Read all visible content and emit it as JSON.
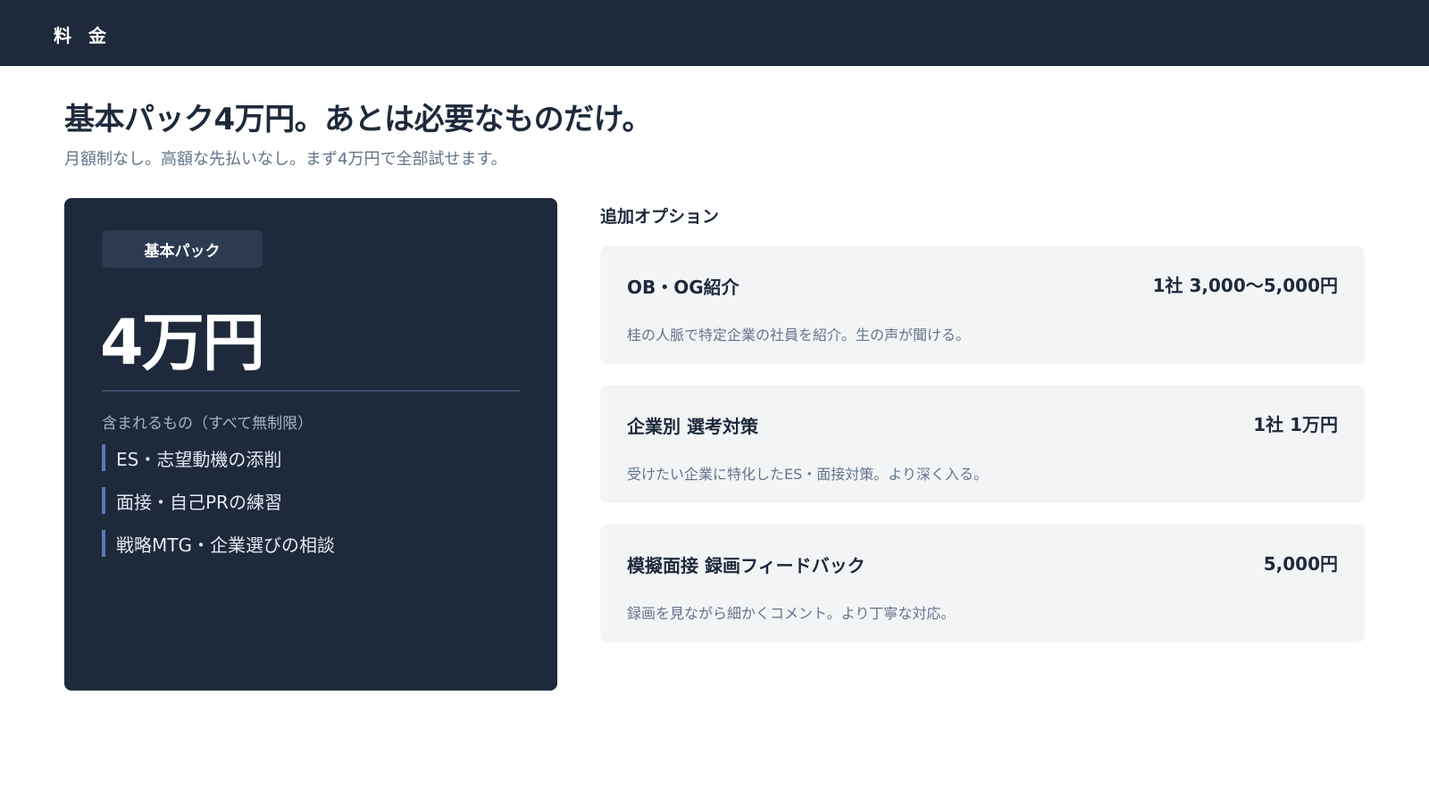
{
  "header": {
    "title": "料 金"
  },
  "hero": {
    "headline": "基本パック4万円。あとは必要なものだけ。",
    "subline": "月額制なし。高額な先払いなし。まず4万円で全部試せます。"
  },
  "base_pack": {
    "badge": "基本パック",
    "price": "4万円",
    "included_label": "含まれるもの（すべて無制限）",
    "included": [
      "ES・志望動機の添削",
      "面接・自己PRの練習",
      "戦略MTG・企業選びの相談"
    ]
  },
  "options": {
    "heading": "追加オプション",
    "items": [
      {
        "name": "OB・OG紹介",
        "price": "1社 3,000〜5,000円",
        "desc": "桂の人脈で特定企業の社員を紹介。生の声が聞ける。"
      },
      {
        "name": "企業別 選考対策",
        "price": "1社 1万円",
        "desc": "受けたい企業に特化したES・面接対策。より深く入る。"
      },
      {
        "name": "模擬面接 録画フィードバック",
        "price": "5,000円",
        "desc": "録画を見ながら細かくコメント。より丁寧な対応。"
      }
    ]
  },
  "colors": {
    "navy": "#1e293b",
    "accent_bar": "#5b7bb5",
    "card_bg": "#f3f4f6",
    "muted_text": "#64748b"
  }
}
